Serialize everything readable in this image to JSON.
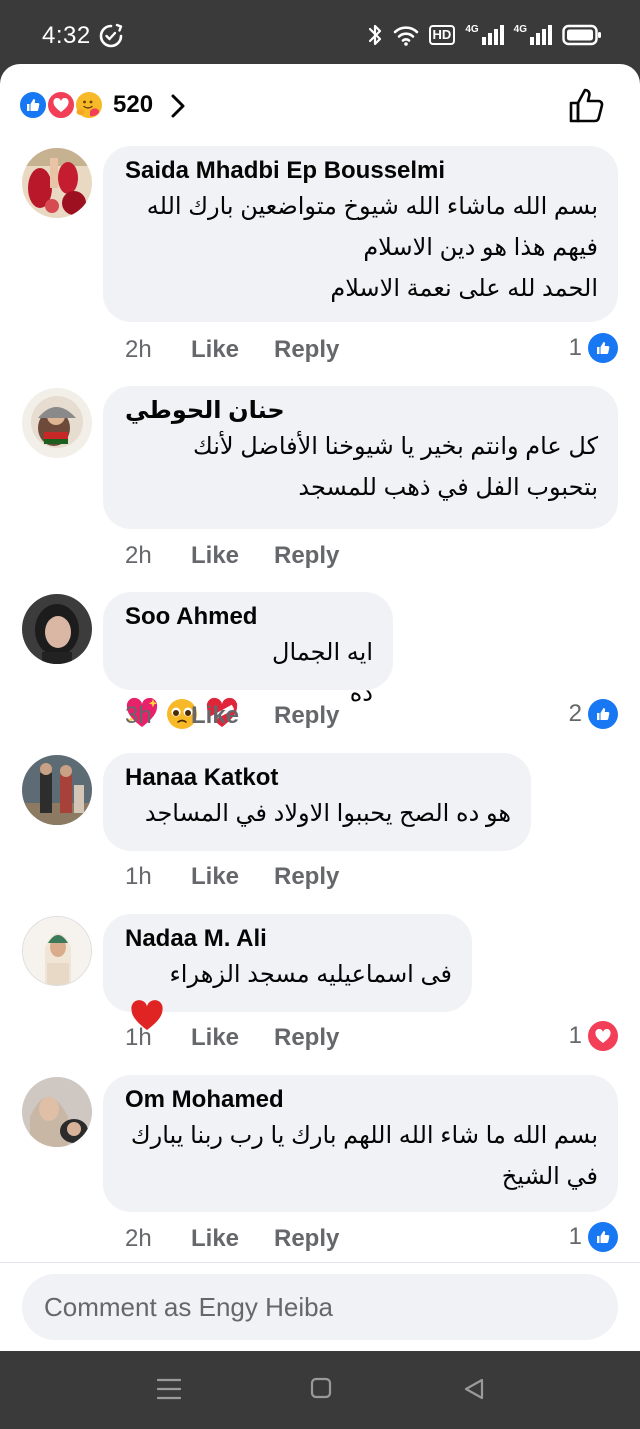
{
  "status": {
    "time": "4:32",
    "hd_label": "HD",
    "sig1_label": "4G",
    "sig2_label": "4G"
  },
  "header": {
    "reaction_count": "520",
    "reactions": [
      "like",
      "love",
      "care"
    ]
  },
  "comments": [
    {
      "author": "Saida Mhadbi Ep Bousselmi",
      "text": "بسم الله ماشاء الله شيوخ متواضعين  بارك الله\nفيهم هذا هو دين الاسلام\nالحمد لله على نعمة الاسلام",
      "time": "2h",
      "like_label": "Like",
      "reply_label": "Reply",
      "reaction_count": "1",
      "reaction_type": "like"
    },
    {
      "author": "حنان الحوطي",
      "text": "كل عام وانتم بخير يا شيوخنا الأفاضل لأنك\nبتحبوب الفل في ذهب للمسجد",
      "time": "2h",
      "like_label": "Like",
      "reply_label": "Reply",
      "reaction_count": "",
      "reaction_type": ""
    },
    {
      "author": "Soo Ahmed",
      "text": "ايه الجمال ده",
      "time": "3h",
      "like_label": "Like",
      "reply_label": "Reply",
      "reaction_count": "2",
      "reaction_type": "like"
    },
    {
      "author": "Hanaa Katkot",
      "text": "هو ده الصح يحببوا الاولاد في المساجد",
      "time": "1h",
      "like_label": "Like",
      "reply_label": "Reply",
      "reaction_count": "",
      "reaction_type": ""
    },
    {
      "author": "Nadaa M. Ali",
      "text": "فى اسماعيليه مسجد الزهراء",
      "time": "1h",
      "like_label": "Like",
      "reply_label": "Reply",
      "reaction_count": "1",
      "reaction_type": "love"
    },
    {
      "author": "Om Mohamed",
      "text": "بسم الله ما شاء الله اللهم بارك يا رب ربنا يبارك\nفي الشيخ",
      "time": "2h",
      "like_label": "Like",
      "reply_label": "Reply",
      "reaction_count": "1",
      "reaction_type": "like"
    }
  ],
  "composer": {
    "placeholder": "Comment as Engy Heiba"
  },
  "colors": {
    "like_blue": "#1877f2",
    "love_red": "#f33e58",
    "bubble_bg": "#f0f2f5",
    "secondary_text": "#65676b"
  }
}
